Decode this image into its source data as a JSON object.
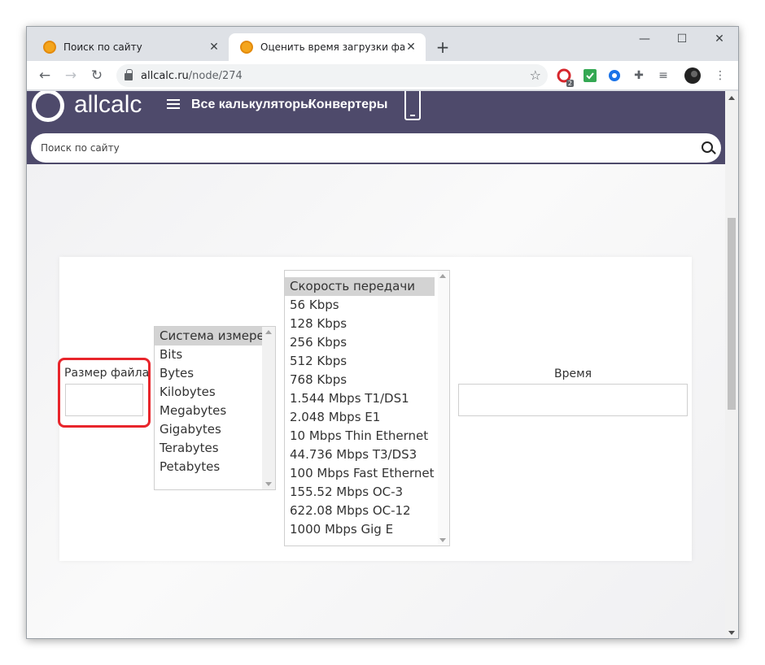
{
  "browser": {
    "tabs": [
      {
        "title": "Поиск по сайту",
        "active": false
      },
      {
        "title": "Оценить время загрузки файла",
        "active": true
      }
    ],
    "url_host": "allcalc.ru",
    "url_path": "/node/274",
    "extension_badge": "2",
    "icons": {
      "back": "back-arrow-icon",
      "forward": "forward-arrow-icon",
      "reload": "reload-icon",
      "bookmark": "star-icon",
      "new_tab": "plus-icon"
    }
  },
  "site": {
    "logo_text": "allcalc",
    "nav": [
      "Все калькуляторы",
      "Конвертеры"
    ],
    "search_placeholder": "Поиск по сайту"
  },
  "calculator": {
    "file_size_label": "Размер файла",
    "file_size_value": "",
    "units": {
      "selected": "Система измерения",
      "options": [
        "Система измерения",
        "Bits",
        "Bytes",
        "Kilobytes",
        "Megabytes",
        "Gigabytes",
        "Terabytes",
        "Petabytes"
      ]
    },
    "speed": {
      "selected": "Скорость передачи",
      "options": [
        "Скорость передачи",
        "56 Kbps",
        "128 Kbps",
        "256 Kbps",
        "512 Kbps",
        "768 Kbps",
        "1.544 Mbps T1/DS1",
        "2.048 Mbps E1",
        "10 Mbps Thin Ethernet",
        "44.736 Mbps T3/DS3",
        "100 Mbps Fast Ethernet",
        "155.52 Mbps OC-3",
        "622.08 Mbps OC-12",
        "1000 Mbps Gig E"
      ]
    },
    "time_label": "Время",
    "time_value": ""
  },
  "colors": {
    "header_bg": "#4e4a6b",
    "highlight": "#e8252b",
    "selected_option_bg": "#d3d3d3"
  }
}
